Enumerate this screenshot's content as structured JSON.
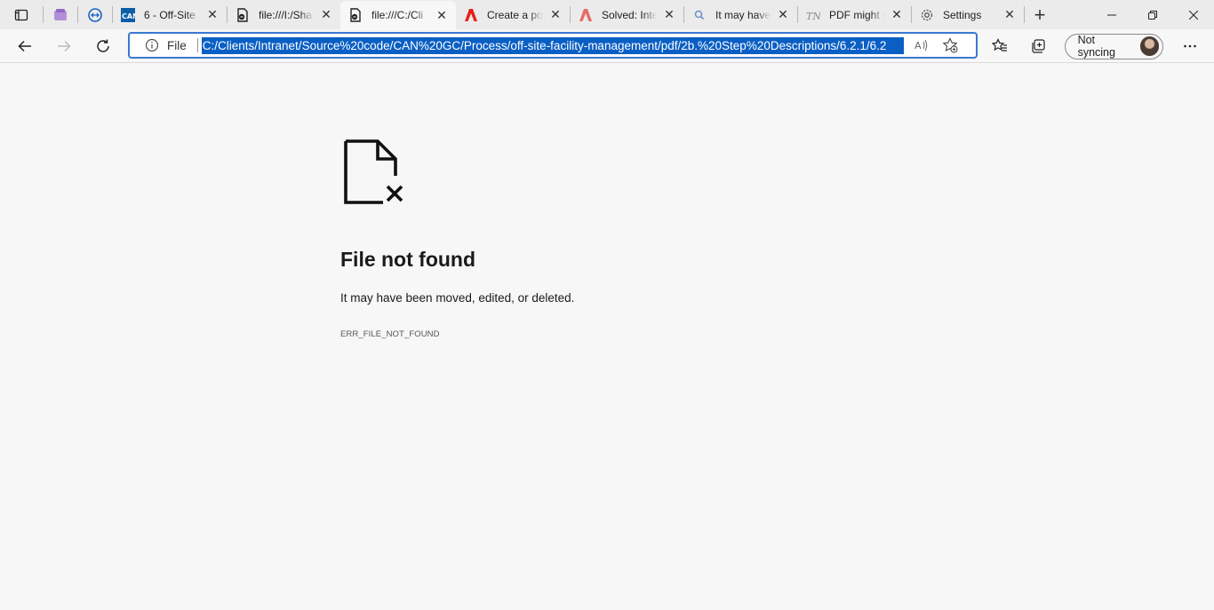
{
  "tabs": [
    {
      "title": "6 - Off-Site",
      "icon": "can-logo-icon",
      "active": false
    },
    {
      "title": "file:///I:/Sha",
      "icon": "pdf-file-icon",
      "active": false
    },
    {
      "title": "file:///C:/Cli",
      "icon": "pdf-file-icon",
      "active": true
    },
    {
      "title": "Create a po",
      "icon": "adobe-icon",
      "active": false
    },
    {
      "title": "Solved: Inte",
      "icon": "adobe-icon",
      "active": false
    },
    {
      "title": "It may have",
      "icon": "search-icon",
      "active": false
    },
    {
      "title": "PDF might n",
      "icon": "tn-logo-icon",
      "active": false
    },
    {
      "title": "Settings",
      "icon": "gear-icon",
      "active": false
    }
  ],
  "address_bar": {
    "scheme": "File",
    "url": "C:/Clients/Intranet/Source%20code/CAN%20GC/Process/off-site-facility-management/pdf/2b.%20Step%20Descriptions/6.2.1/6.2"
  },
  "profile": {
    "label": "Not syncing"
  },
  "error": {
    "title": "File not found",
    "message": "It may have been moved, edited, or deleted.",
    "code": "ERR_FILE_NOT_FOUND"
  },
  "colors": {
    "accent": "#0a5fc4",
    "focus_ring": "#3a78d0",
    "background": "#f7f7f7",
    "tabstrip": "#ebebeb"
  }
}
